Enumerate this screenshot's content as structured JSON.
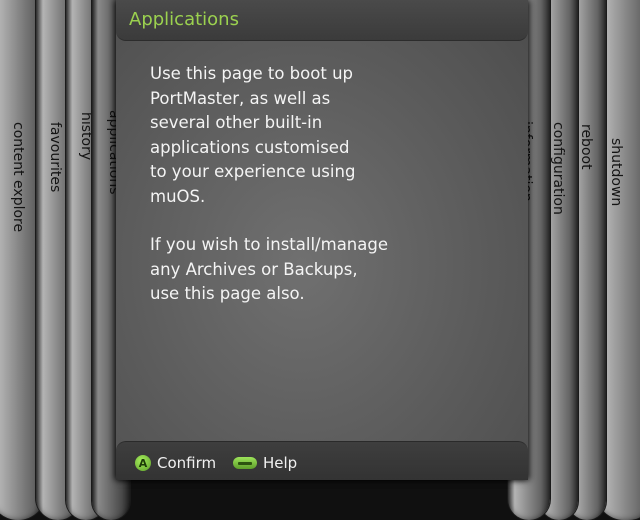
{
  "header": {
    "title": "Applications"
  },
  "content": {
    "paragraphs": [
      "Use this page to boot up\nPortMaster, as well as\nseveral other built-in\napplications customised\nto your experience using\nmuOS.",
      "If you wish to install/manage\nany Archives or Backups,\nuse this page also."
    ]
  },
  "left_tabs": [
    "content explore",
    "favourites",
    "history",
    "applications"
  ],
  "active_tab": "applications",
  "right_tabs": [
    "information",
    "configuration",
    "reboot",
    "shutdown"
  ],
  "footer": {
    "hints": [
      {
        "button": "A",
        "label": "Confirm",
        "icon": "a-button-icon"
      },
      {
        "button": "menu",
        "label": "Help",
        "icon": "menu-button-icon"
      }
    ]
  },
  "colors": {
    "title": "#9bd14f",
    "button_green": "#7cc13f",
    "text": "#f4f4f4"
  }
}
